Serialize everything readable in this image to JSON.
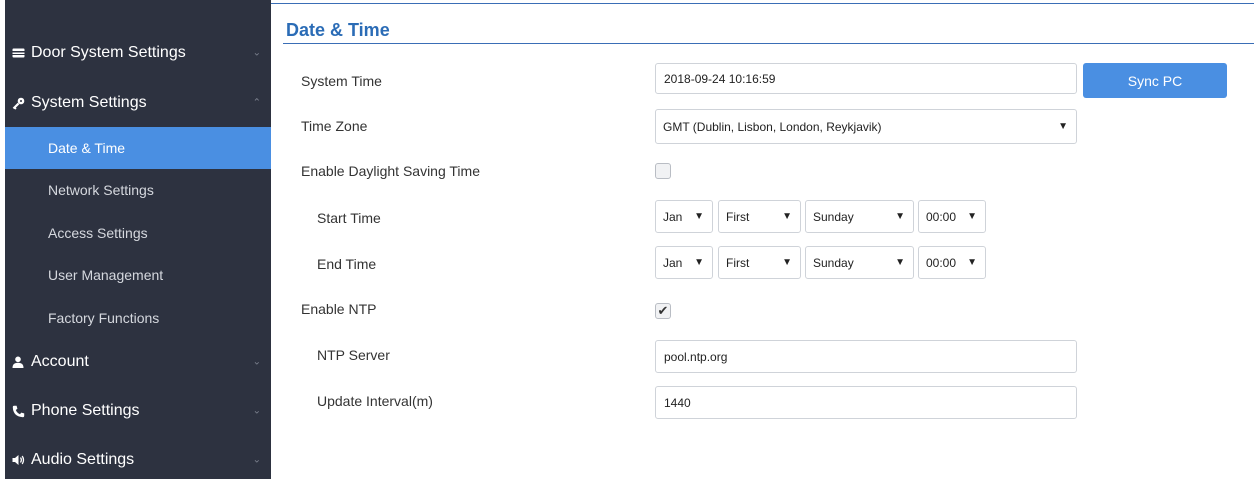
{
  "sidebar": {
    "items": [
      {
        "label": "Door System Settings",
        "icon": "card-icon"
      },
      {
        "label": "System Settings",
        "icon": "key-icon"
      },
      {
        "label": "Date & Time"
      },
      {
        "label": "Network Settings"
      },
      {
        "label": "Access Settings"
      },
      {
        "label": "User Management"
      },
      {
        "label": "Factory Functions"
      },
      {
        "label": "Account",
        "icon": "user-icon"
      },
      {
        "label": "Phone Settings",
        "icon": "phone-icon"
      },
      {
        "label": "Audio Settings",
        "icon": "speaker-icon"
      }
    ],
    "chevron_down": "⌄",
    "chevron_up": "⌃"
  },
  "main": {
    "title": "Date & Time",
    "system_time": {
      "label": "System Time",
      "value": "2018-09-24 10:16:59",
      "sync_label": "Sync PC"
    },
    "time_zone": {
      "label": "Time Zone",
      "value": "GMT (Dublin, Lisbon, London, Reykjavik)"
    },
    "dst": {
      "label": "Enable Daylight Saving Time",
      "checked": false
    },
    "start_time": {
      "label": "Start Time",
      "month": "Jan",
      "week": "First",
      "day": "Sunday",
      "time": "00:00"
    },
    "end_time": {
      "label": "End Time",
      "month": "Jan",
      "week": "First",
      "day": "Sunday",
      "time": "00:00"
    },
    "ntp": {
      "label": "Enable NTP",
      "checked": true,
      "check_glyph": "✔"
    },
    "ntp_server": {
      "label": "NTP Server",
      "value": "pool.ntp.org"
    },
    "update_interval": {
      "label": "Update Interval(m)",
      "value": "1440"
    },
    "dropdown_arrow": "▼"
  },
  "colors": {
    "sidebar_bg": "#2d3240",
    "accent": "#4a8fe2",
    "title": "#2b6cb6"
  }
}
